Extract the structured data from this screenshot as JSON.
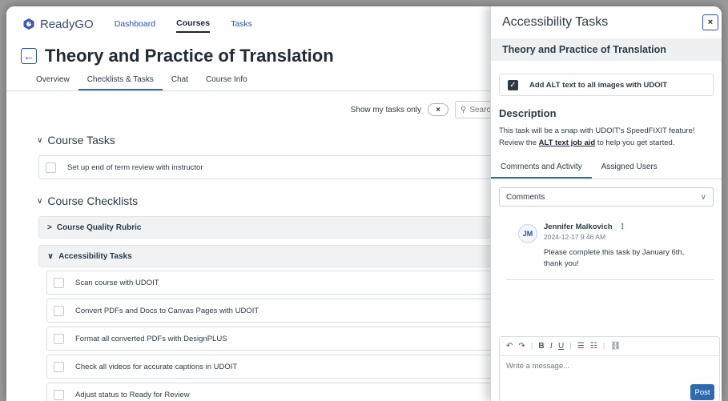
{
  "brand": {
    "name": "ReadyGO"
  },
  "topnav": {
    "items": [
      "Dashboard",
      "Courses",
      "Tasks"
    ],
    "active": "Courses"
  },
  "page": {
    "title": "Theory and Practice of Translation"
  },
  "tabs": [
    "Overview",
    "Checklists & Tasks",
    "Chat",
    "Course Info"
  ],
  "filter": {
    "label": "Show my tasks only",
    "search_placeholder": "Search"
  },
  "course_tasks": {
    "heading": "Course Tasks",
    "items": [
      "Set up end of term review with instructor"
    ]
  },
  "course_checklists": {
    "heading": "Course Checklists",
    "groups": [
      {
        "title": "Course Quality Rubric",
        "expanded": false
      },
      {
        "title": "Accessibility Tasks",
        "expanded": true
      }
    ],
    "accessibility_items": [
      "Scan course with UDOIT",
      "Convert PDFs and Docs to Canvas Pages with UDOIT",
      "Format all converted PDFs with DesignPLUS",
      "Check all videos for accurate captions in UDOIT",
      "Adjust status to Ready for Review"
    ]
  },
  "panel": {
    "title": "Accessibility Tasks",
    "course": "Theory and Practice of Translation",
    "task": {
      "label": "Add ALT text to all images with UDOIT",
      "checked": true
    },
    "description": {
      "heading": "Description",
      "line1": "This task will be a snap with UDOIT's SpeedFIXIT feature!",
      "line2_pre": "Review the ",
      "link": "ALT text job aid",
      "line2_post": " to help you get started."
    },
    "tabs": [
      "Comments and Activity",
      "Assigned Users"
    ],
    "select": {
      "value": "Comments"
    },
    "comment": {
      "initials": "JM",
      "author": "Jennifer Malkovich",
      "time": "2024-12-17 9:46 AM",
      "text": "Please complete this task by January 6th, thank you!"
    },
    "composer": {
      "placeholder": "Write a message...",
      "post_label": "Post"
    }
  },
  "colors": {
    "accent": "#2b6cb0",
    "link": "#2b4fb8",
    "text": "#2d3b45"
  }
}
